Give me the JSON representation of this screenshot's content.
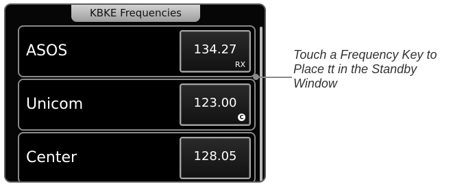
{
  "panel": {
    "title": "KBKE Frequencies",
    "rows": [
      {
        "label": "ASOS",
        "frequency": "134.27",
        "suffix": "RX"
      },
      {
        "label": "Unicom",
        "frequency": "123.00",
        "badge_icon": "c-circle-icon",
        "badge_text": "C"
      },
      {
        "label": "Center",
        "frequency": "128.05"
      }
    ]
  },
  "annotation": {
    "text": "Touch a Frequency Key to Place tt in the Standby Window"
  }
}
